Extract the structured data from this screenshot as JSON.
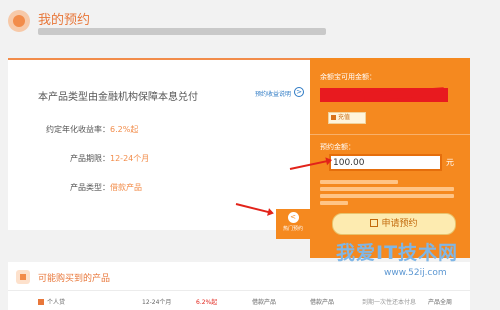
{
  "header": {
    "title": "我的预约"
  },
  "product": {
    "description": "本产品类型由金融机构保障本息兑付",
    "profit_link": "预约收益说明",
    "profit_icon": ">",
    "rate_label": "约定年化收益率：",
    "rate_value": "6.2%起",
    "period_label": "产品期限：",
    "period_value": "12-24个月",
    "type_label": "产品类型：",
    "type_value": "借款产品"
  },
  "panel": {
    "balance_label": "余额宝可用金额：",
    "recharge_label": "充值",
    "reserve_label": "预约金额：",
    "amount_value": "100.00",
    "unit": "元",
    "apply_label": "申请预约"
  },
  "hot_tab": {
    "icon": "<",
    "label": "热门预约"
  },
  "bottom": {
    "title": "可能购买到的产品",
    "row": {
      "name": "个人贷",
      "period": "12-24个月",
      "rate": "6.2%起",
      "type": "借款产品",
      "col5": "借款产品",
      "col6": "到期一次性还本付息",
      "col7": "产品全周"
    }
  },
  "watermark": {
    "text": "我爱IT技术网",
    "site": "www.52ij.com"
  },
  "colors": {
    "accent_orange": "#f5891f",
    "title_orange": "#e8773a",
    "link_blue": "#2c79c4",
    "arrow_red": "#e2231a"
  }
}
